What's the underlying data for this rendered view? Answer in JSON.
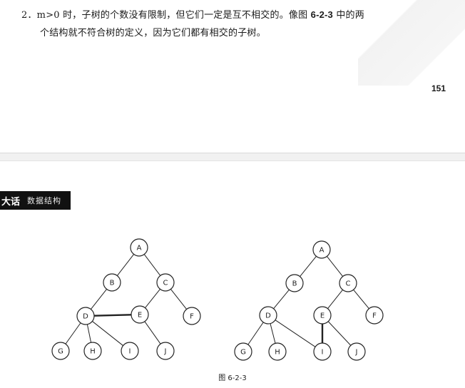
{
  "page_text": {
    "num": "2．",
    "line1_a": "m>0 时，子树的个数没有限制，但它们一定是互不相交的。像图 ",
    "fig_ref": "6-2-3",
    "line1_b": " 中的两",
    "line2": "个结构就不符合树的定义，因为它们都有相交的子树。",
    "page_number": "151"
  },
  "header": {
    "left": "大话",
    "right": "数据结构"
  },
  "figure": {
    "caption": "图 6-2-3",
    "trees": [
      {
        "nodes": [
          "A",
          "B",
          "C",
          "D",
          "E",
          "F",
          "G",
          "H",
          "I",
          "J"
        ],
        "edges": [
          [
            "A",
            "B"
          ],
          [
            "A",
            "C"
          ],
          [
            "B",
            "D"
          ],
          [
            "C",
            "E"
          ],
          [
            "C",
            "F"
          ],
          [
            "D",
            "G"
          ],
          [
            "D",
            "H"
          ],
          [
            "D",
            "I"
          ],
          [
            "D",
            "E"
          ],
          [
            "E",
            "J"
          ]
        ],
        "crossing_edge": [
          "D",
          "E"
        ]
      },
      {
        "nodes": [
          "A",
          "B",
          "C",
          "D",
          "E",
          "F",
          "G",
          "H",
          "I",
          "J"
        ],
        "edges": [
          [
            "A",
            "B"
          ],
          [
            "A",
            "C"
          ],
          [
            "B",
            "D"
          ],
          [
            "C",
            "E"
          ],
          [
            "C",
            "F"
          ],
          [
            "D",
            "G"
          ],
          [
            "D",
            "H"
          ],
          [
            "D",
            "I"
          ],
          [
            "E",
            "I"
          ],
          [
            "E",
            "J"
          ]
        ],
        "crossing_edge": [
          "E",
          "I"
        ]
      }
    ]
  }
}
